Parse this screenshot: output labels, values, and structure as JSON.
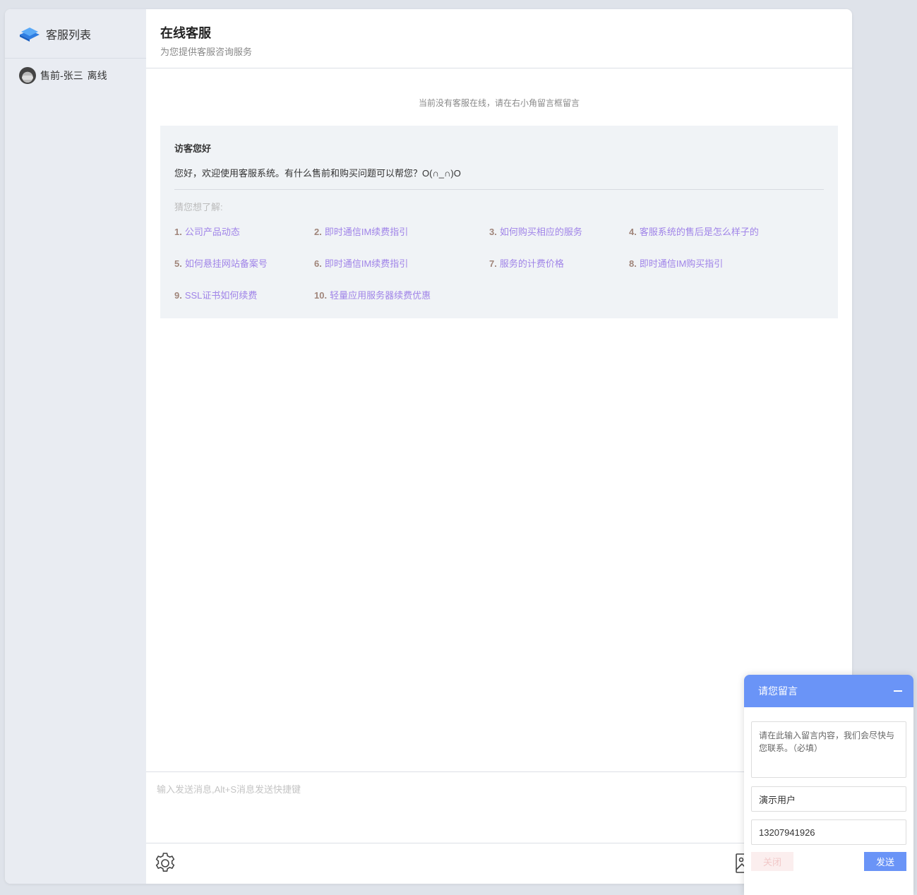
{
  "colors": {
    "accent": "#6a94f7",
    "link": "#a084e8",
    "link_number": "#a0857a",
    "page_bg": "#dfe3ea",
    "sidebar_bg": "#e9ecf2",
    "welcome_bg": "#f0f3f6"
  },
  "sidebar": {
    "logo_icon": "layers-logo-icon",
    "title": "客服列表",
    "agents": [
      {
        "name": "售前-张三",
        "status": "离线",
        "avatar_icon": "avatar"
      }
    ]
  },
  "header": {
    "title": "在线客服",
    "subtitle": "为您提供客服咨询服务"
  },
  "chat": {
    "notice": "当前没有客服在线，请在右小角留言框留言",
    "welcome": {
      "title": "访客您好",
      "message": "您好，欢迎使用客服系统。有什么售前和购买问题可以帮您？O(∩_∩)O",
      "guess_label": "猜您想了解:",
      "faq": [
        {
          "num": "1.",
          "text": "公司产品动态"
        },
        {
          "num": "2.",
          "text": "即时通信IM续费指引"
        },
        {
          "num": "3.",
          "text": "如何购买相应的服务"
        },
        {
          "num": "4.",
          "text": "客服系统的售后是怎么样子的"
        },
        {
          "num": "5.",
          "text": "如何悬挂网站备案号"
        },
        {
          "num": "6.",
          "text": "即时通信IM续费指引"
        },
        {
          "num": "7.",
          "text": "服务的计费价格"
        },
        {
          "num": "8.",
          "text": "即时通信IM购买指引"
        },
        {
          "num": "9.",
          "text": "SSL证书如何续费"
        },
        {
          "num": "10.",
          "text": "轻量应用服务器续费优惠"
        }
      ]
    }
  },
  "composer": {
    "placeholder": "输入发送消息,Alt+S消息发送快捷键",
    "settings_icon": "gear-icon",
    "image_icon": "image-icon"
  },
  "message_panel": {
    "title": "请您留言",
    "minimize_icon": "minimize-icon",
    "content_placeholder": "请在此输入留言内容，我们会尽快与您联系。（必填）",
    "name_value": "演示用户",
    "phone_value": "13207941926",
    "close_label": "关闭",
    "send_label": "发送"
  }
}
